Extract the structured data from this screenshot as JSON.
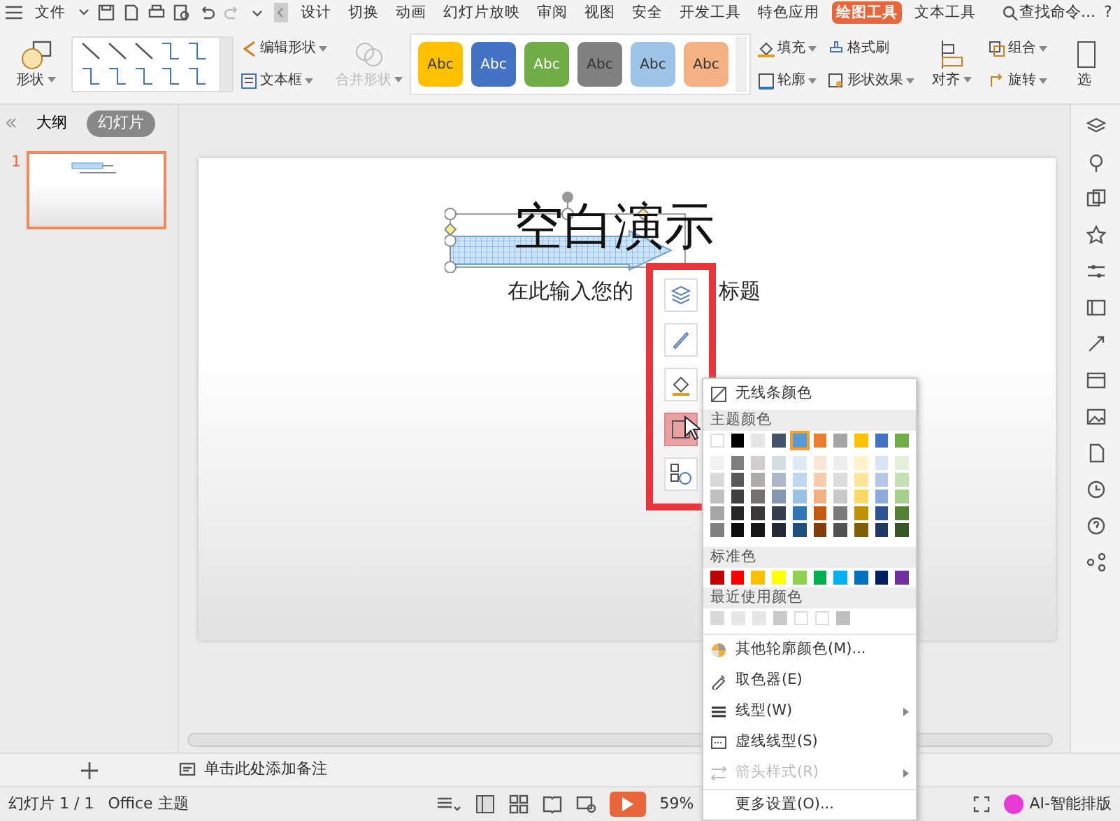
{
  "menubar": {
    "file_menu": "文件",
    "tabs": [
      {
        "label": "设计",
        "selected": false
      },
      {
        "label": "切换",
        "selected": false
      },
      {
        "label": "动画",
        "selected": false
      },
      {
        "label": "幻灯片放映",
        "selected": false
      },
      {
        "label": "审阅",
        "selected": false
      },
      {
        "label": "视图",
        "selected": false
      },
      {
        "label": "安全",
        "selected": false
      },
      {
        "label": "开发工具",
        "selected": false
      },
      {
        "label": "特色应用",
        "selected": false
      },
      {
        "label": "绘图工具",
        "selected": true
      },
      {
        "label": "文本工具",
        "selected": false
      }
    ],
    "search": "查找命令...",
    "help": "?"
  },
  "ribbon": {
    "shape_button": "形状",
    "edit_shape": "编辑形状",
    "text_box": "文本框",
    "merge_shape": {
      "label": "合并形状",
      "disabled": true
    },
    "style_gallery": [
      {
        "label": "Abc",
        "color": "#ffc000"
      },
      {
        "label": "Abc",
        "color": "#4472c4"
      },
      {
        "label": "Abc",
        "color": "#70ad47"
      },
      {
        "label": "Abc",
        "color": "#808080"
      },
      {
        "label": "Abc",
        "color": "#9dc3e6"
      },
      {
        "label": "Abc",
        "color": "#f4b183"
      }
    ],
    "fill": "填充",
    "format_painter": "格式刷",
    "outline": "轮廓",
    "shape_effects": "形状效果",
    "align": "对齐",
    "group": "组合",
    "rotate": "旋转",
    "select": "选"
  },
  "panel": {
    "tabs": [
      {
        "label": "大纲",
        "selected": false
      },
      {
        "label": "幻灯片",
        "selected": true
      }
    ],
    "slides": [
      {
        "number": "1",
        "selected": true
      }
    ]
  },
  "slide": {
    "title": "空白演示",
    "subtitle_fragments": [
      "在此输入您的",
      "标题"
    ]
  },
  "floating_toolbar": {
    "buttons": [
      {
        "hovered": false
      },
      {
        "hovered": false
      },
      {
        "hovered": false
      },
      {
        "hovered": true
      },
      {
        "hovered": false
      }
    ]
  },
  "outline_menu": {
    "no_line": "无线条颜色",
    "theme_header": "主题颜色",
    "theme_colors": [
      {
        "color": "#ffffff",
        "selected": false
      },
      {
        "color": "#000000",
        "selected": false
      },
      {
        "color": "#e7e6e6",
        "selected": false
      },
      {
        "color": "#44546a",
        "selected": false
      },
      {
        "color": "#5b9bd5",
        "selected": true
      },
      {
        "color": "#ed7d31",
        "selected": false
      },
      {
        "color": "#a5a5a5",
        "selected": false
      },
      {
        "color": "#ffc000",
        "selected": false
      },
      {
        "color": "#4472c4",
        "selected": false
      },
      {
        "color": "#70ad47",
        "selected": false
      }
    ],
    "theme_shades": [
      {
        "swatches": [
          {
            "color": "#f2f2f2"
          },
          {
            "color": "#7f7f7f"
          },
          {
            "color": "#d0cece"
          },
          {
            "color": "#d6dce4"
          },
          {
            "color": "#deebf6"
          },
          {
            "color": "#fbe5d5"
          },
          {
            "color": "#ededed"
          },
          {
            "color": "#fff2cc"
          },
          {
            "color": "#dae3f3"
          },
          {
            "color": "#e2efd9"
          }
        ]
      },
      {
        "swatches": [
          {
            "color": "#d9d9d9"
          },
          {
            "color": "#595959"
          },
          {
            "color": "#aeabab"
          },
          {
            "color": "#adb9ca"
          },
          {
            "color": "#bdd7ee"
          },
          {
            "color": "#f7cbac"
          },
          {
            "color": "#dbdbdb"
          },
          {
            "color": "#fee599"
          },
          {
            "color": "#b4c7e7"
          },
          {
            "color": "#c5e0b3"
          }
        ]
      },
      {
        "swatches": [
          {
            "color": "#bfbfbf"
          },
          {
            "color": "#404040"
          },
          {
            "color": "#757171"
          },
          {
            "color": "#8496b0"
          },
          {
            "color": "#9cc3e5"
          },
          {
            "color": "#f4b183"
          },
          {
            "color": "#c9c9c9"
          },
          {
            "color": "#ffd965"
          },
          {
            "color": "#8faadc"
          },
          {
            "color": "#a8d08d"
          }
        ]
      },
      {
        "swatches": [
          {
            "color": "#a6a6a6"
          },
          {
            "color": "#262626"
          },
          {
            "color": "#3a3838"
          },
          {
            "color": "#333f4f"
          },
          {
            "color": "#2e75b5"
          },
          {
            "color": "#c55a11"
          },
          {
            "color": "#7b7b7b"
          },
          {
            "color": "#bf9000"
          },
          {
            "color": "#2f5496"
          },
          {
            "color": "#538135"
          }
        ]
      },
      {
        "swatches": [
          {
            "color": "#808080"
          },
          {
            "color": "#0d0d0d"
          },
          {
            "color": "#171616"
          },
          {
            "color": "#222a35"
          },
          {
            "color": "#1e4e79"
          },
          {
            "color": "#843c0b"
          },
          {
            "color": "#525252"
          },
          {
            "color": "#7f6000"
          },
          {
            "color": "#1f3864"
          },
          {
            "color": "#375623"
          }
        ]
      }
    ],
    "standard_header": "标准色",
    "standard_colors": [
      {
        "color": "#c00000"
      },
      {
        "color": "#ff0000"
      },
      {
        "color": "#ffc000"
      },
      {
        "color": "#ffff00"
      },
      {
        "color": "#92d050"
      },
      {
        "color": "#00b050"
      },
      {
        "color": "#00b0f0"
      },
      {
        "color": "#0070c0"
      },
      {
        "color": "#002060"
      },
      {
        "color": "#7030a0"
      }
    ],
    "recent_header": "最近使用颜色",
    "recent_colors": [
      {
        "color": "#d9d9d9"
      },
      {
        "color": "#e7e6e6"
      },
      {
        "color": "#e7e6e6"
      },
      {
        "color": "#c9c9c9"
      },
      {
        "color": "#ffffff"
      },
      {
        "color": "#ffffff"
      },
      {
        "color": "#bfbfbf"
      }
    ],
    "items": [
      {
        "label": "其他轮廓颜色(M)...",
        "disabled": false,
        "submenu": false
      },
      {
        "label": "取色器(E)",
        "disabled": false,
        "submenu": false
      },
      {
        "label": "线型(W)",
        "disabled": false,
        "submenu": true
      },
      {
        "label": "虚线线型(S)",
        "disabled": false,
        "submenu": false
      },
      {
        "label": "箭头样式(R)",
        "disabled": true,
        "submenu": true
      },
      {
        "label": "更多设置(O)...",
        "disabled": false,
        "submenu": false
      }
    ]
  },
  "notes": {
    "placeholder": "单击此处添加备注"
  },
  "status_bar": {
    "slide_counter": "幻灯片 1 / 1",
    "theme": "Office 主题",
    "zoom": "59%",
    "ai_button": "AI-智能排版"
  }
}
